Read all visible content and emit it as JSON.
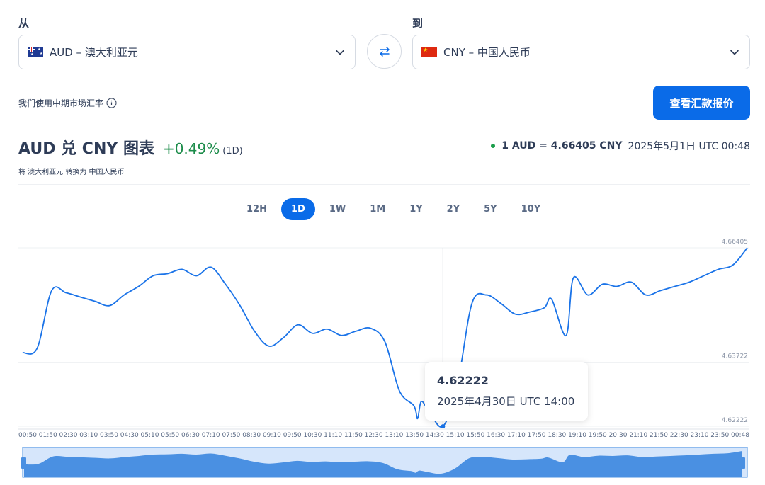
{
  "from": {
    "label": "从",
    "currency": "AUD – 澳大利亚元"
  },
  "to": {
    "label": "到",
    "currency": "CNY – 中国人民币"
  },
  "swap_icon": "swap-arrows-icon",
  "midmarket": {
    "text": "我们使用中期市场汇率",
    "icon": "info-icon"
  },
  "quote_button": "查看汇款报价",
  "header": {
    "title": "AUD 兑 CNY 图表",
    "change": "+0.49%",
    "change_period": "(1D)",
    "subtitle": "将 澳大利亚元 转换为 中国人民币",
    "rate": "1 AUD = 4.66405 CNY",
    "timestamp": "2025年5月1日 UTC 00:48"
  },
  "periods": [
    "12H",
    "1D",
    "1W",
    "1M",
    "1Y",
    "2Y",
    "5Y",
    "10Y"
  ],
  "active_period": "1D",
  "tooltip": {
    "value": "4.62222",
    "date": "2025年4月30日 UTC 14:00"
  },
  "colors": {
    "accent": "#0a6be8",
    "line": "#1a73e8",
    "positive": "#1c8c4a",
    "navigator_fill": "#4a90e2"
  },
  "chart_data": {
    "type": "line",
    "y_tick_labels": [
      "4.66405",
      "4.63722",
      "4.62222"
    ],
    "ylim": [
      4.62222,
      4.66405
    ],
    "x_tick_labels": [
      "00:50",
      "01:50",
      "02:30",
      "03:10",
      "03:50",
      "04:30",
      "05:10",
      "05:50",
      "06:30",
      "07:10",
      "07:50",
      "08:30",
      "09:10",
      "09:50",
      "10:30",
      "11:10",
      "11:50",
      "12:30",
      "13:10",
      "13:50",
      "14:30",
      "15:10",
      "15:50",
      "16:30",
      "17:10",
      "17:50",
      "18:30",
      "19:10",
      "19:50",
      "20:30",
      "21:10",
      "21:50",
      "22:30",
      "23:10",
      "23:50",
      "00:48"
    ],
    "x": [
      0,
      0.02,
      0.04,
      0.06,
      0.08,
      0.1,
      0.12,
      0.14,
      0.16,
      0.18,
      0.2,
      0.22,
      0.24,
      0.26,
      0.28,
      0.3,
      0.32,
      0.34,
      0.36,
      0.38,
      0.4,
      0.42,
      0.44,
      0.46,
      0.48,
      0.5,
      0.52,
      0.54,
      0.545,
      0.55,
      0.56,
      0.58,
      0.6,
      0.62,
      0.64,
      0.66,
      0.68,
      0.7,
      0.72,
      0.73,
      0.75,
      0.76,
      0.78,
      0.8,
      0.82,
      0.84,
      0.86,
      0.88,
      0.9,
      0.92,
      0.94,
      0.96,
      0.98,
      1.0
    ],
    "series": [
      {
        "values": [
          4.6395,
          4.6405,
          4.654,
          4.6535,
          4.6525,
          4.6515,
          4.6505,
          4.653,
          4.655,
          4.6575,
          4.658,
          4.659,
          4.6575,
          4.6595,
          4.6555,
          4.6505,
          4.6445,
          4.641,
          4.643,
          4.646,
          4.644,
          4.645,
          4.6435,
          4.6445,
          4.6452,
          4.642,
          4.6305,
          4.627,
          4.624,
          4.628,
          4.626,
          4.6222,
          4.632,
          4.651,
          4.653,
          4.651,
          4.6485,
          4.649,
          4.65,
          4.652,
          4.6435,
          4.657,
          4.653,
          4.6555,
          4.655,
          4.656,
          4.653,
          4.654,
          4.655,
          4.656,
          4.6575,
          4.659,
          4.66,
          4.66405
        ]
      }
    ]
  }
}
